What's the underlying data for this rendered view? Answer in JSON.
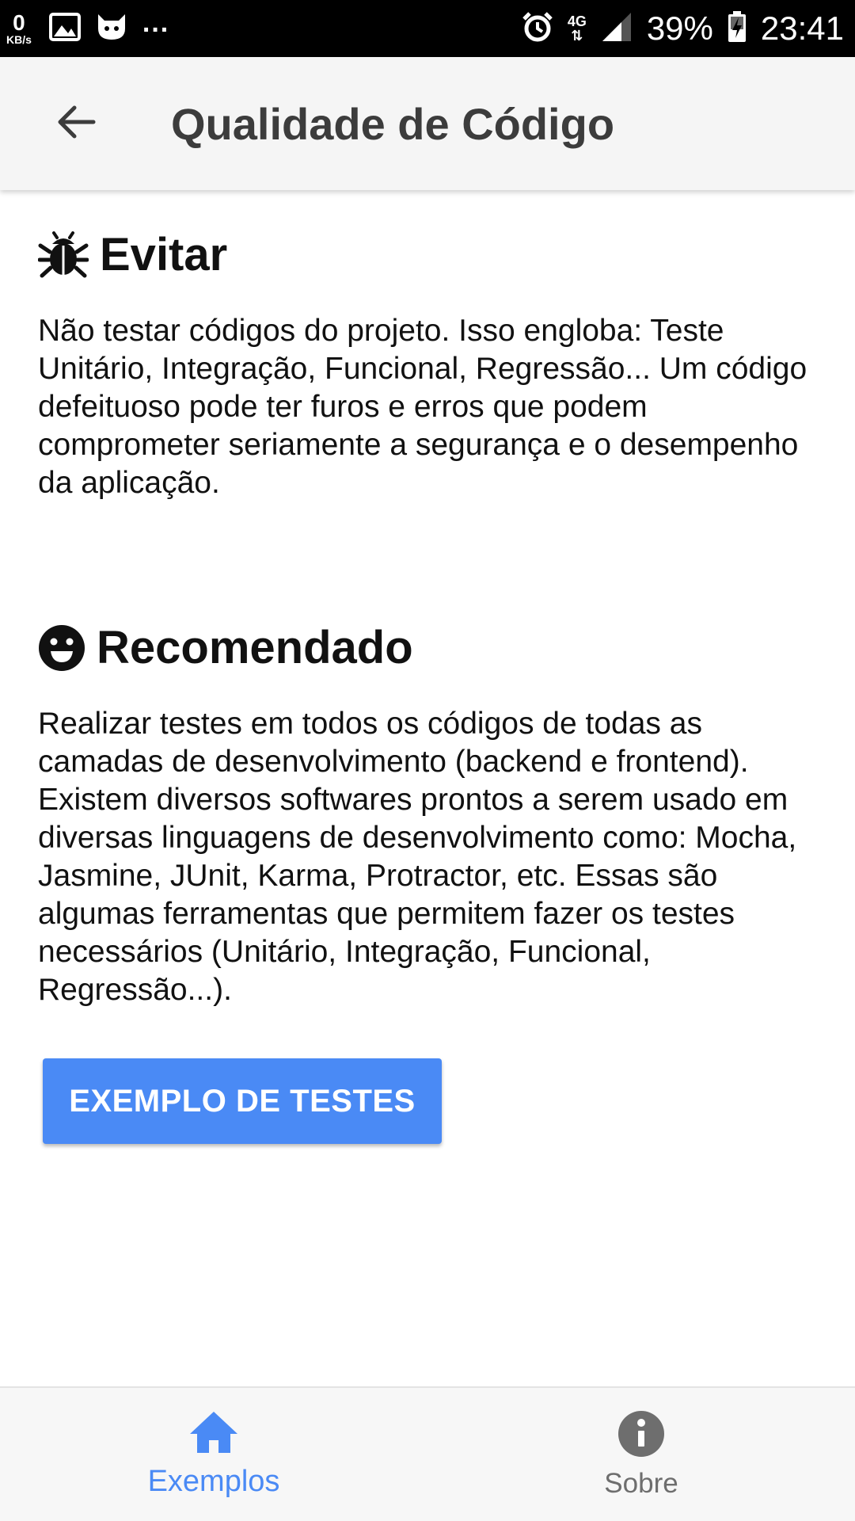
{
  "status_bar": {
    "speed_value": "0",
    "speed_unit": "KB/s",
    "more": "...",
    "network": "4G",
    "battery": "39%",
    "time": "23:41"
  },
  "app_bar": {
    "title": "Qualidade de Código",
    "back_icon": "arrow-left-icon"
  },
  "sections": [
    {
      "icon": "bug-icon",
      "heading": "Evitar",
      "text": "Não testar códigos do projeto. Isso engloba: Teste Unitário, Integração, Funcional, Regressão... Um código defeituoso pode ter furos e erros que podem comprometer seriamente a segurança e o desempenho da aplicação."
    },
    {
      "icon": "smiley-icon",
      "heading": "Recomendado",
      "text": "Realizar testes em todos os códigos de todas as camadas de desenvolvimento (backend e frontend). Existem diversos softwares prontos a serem usado em diversas linguagens de desenvolvimento como: Mocha, Jasmine, JUnit, Karma, Protractor, etc. Essas são algumas ferramentas que permitem fazer os testes necessários (Unitário, Integração, Funcional, Regressão...)."
    }
  ],
  "action_button": {
    "label": "EXEMPLO DE TESTES"
  },
  "bottom_nav": {
    "items": [
      {
        "label": "Exemplos",
        "icon": "home-icon",
        "active": true
      },
      {
        "label": "Sobre",
        "icon": "info-icon",
        "active": false
      }
    ]
  },
  "colors": {
    "accent": "#4a8af5",
    "inactive": "#6e6e6e",
    "app_bar_bg": "#f5f5f5",
    "status_bar_bg": "#000000"
  }
}
